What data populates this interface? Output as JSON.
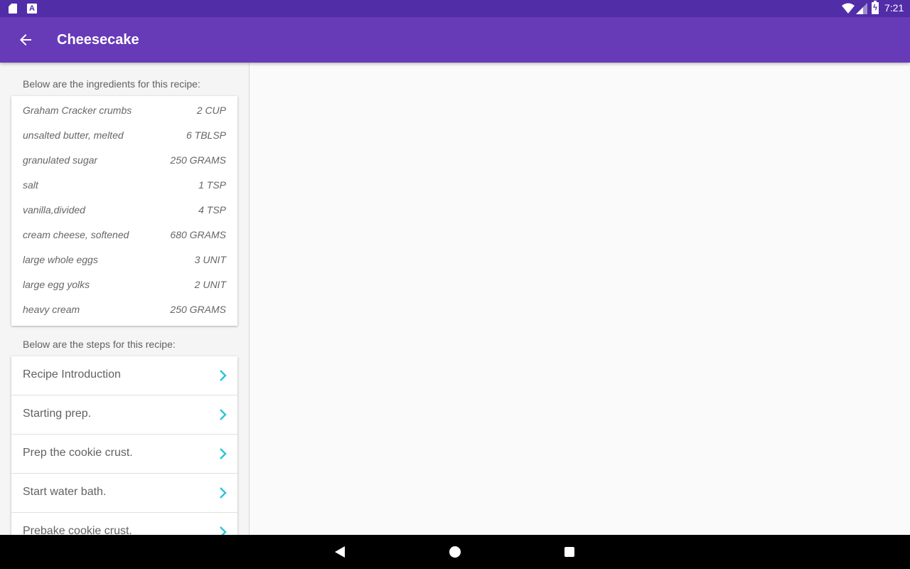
{
  "status_bar": {
    "time": "7:21",
    "notif_letter": "A"
  },
  "app_bar": {
    "title": "Cheesecake"
  },
  "ingredients": {
    "header": "Below are the ingredients for this recipe:",
    "items": [
      {
        "name": "Graham Cracker crumbs",
        "qty": "2 CUP"
      },
      {
        "name": "unsalted butter, melted",
        "qty": "6 TBLSP"
      },
      {
        "name": "granulated sugar",
        "qty": "250 GRAMS"
      },
      {
        "name": "salt",
        "qty": "1 TSP"
      },
      {
        "name": "vanilla,divided",
        "qty": "4 TSP"
      },
      {
        "name": "cream cheese, softened",
        "qty": "680 GRAMS"
      },
      {
        "name": "large whole eggs",
        "qty": "3 UNIT"
      },
      {
        "name": "large egg yolks",
        "qty": "2 UNIT"
      },
      {
        "name": "heavy cream",
        "qty": "250 GRAMS"
      }
    ]
  },
  "steps": {
    "header": "Below are the steps for this recipe:",
    "items": [
      {
        "label": "Recipe Introduction"
      },
      {
        "label": "Starting prep."
      },
      {
        "label": "Prep the cookie crust."
      },
      {
        "label": "Start water bath."
      },
      {
        "label": "Prebake cookie crust."
      }
    ]
  },
  "colors": {
    "status_bar": "#512da8",
    "app_bar": "#673ab7",
    "chevron": "#26c6da"
  }
}
